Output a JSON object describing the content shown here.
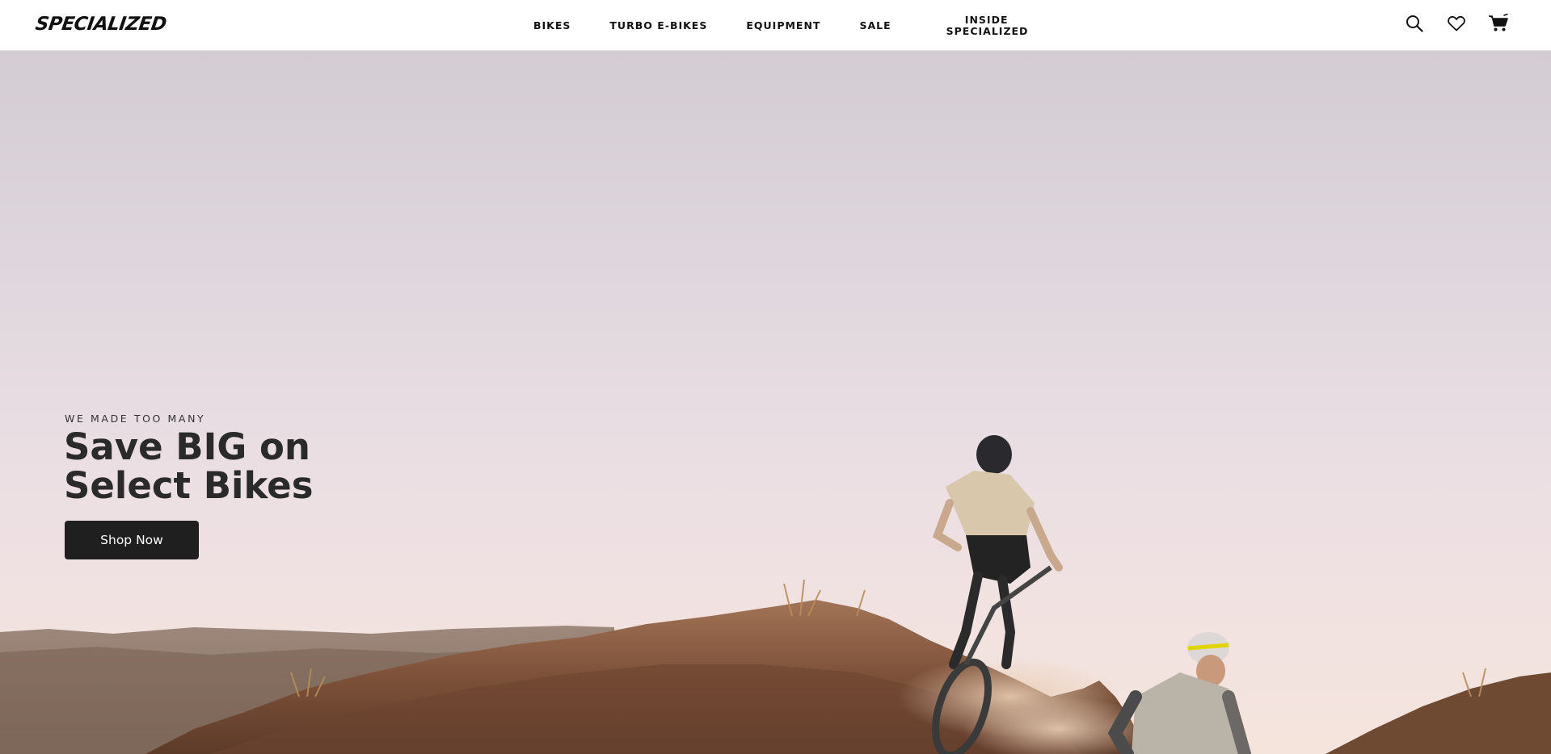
{
  "header": {
    "logo": "SPECIALIZED",
    "nav": [
      {
        "label": "BIKES"
      },
      {
        "label": "TURBO E-BIKES"
      },
      {
        "label": "EQUIPMENT"
      },
      {
        "label": "SALE"
      },
      {
        "label": "INSIDE SPECIALIZED"
      }
    ],
    "icons": [
      "search-icon",
      "heart-icon",
      "cart-icon"
    ]
  },
  "hero": {
    "eyebrow": "WE MADE TOO MANY",
    "headline": "Save BIG on Select Bikes",
    "cta_label": "Shop Now",
    "image": "two-mountain-bikers-riding-desert-dirt-trail",
    "colors": {
      "sky_top": "#d3ccd2",
      "sky_bottom": "#f5e4dc",
      "dirt": "#8a5a3c",
      "cta_bg": "#1f1f1f"
    }
  }
}
